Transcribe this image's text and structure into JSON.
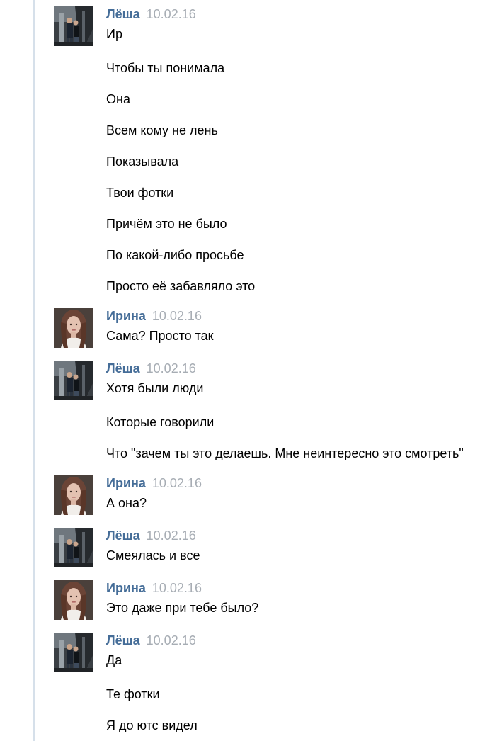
{
  "colors": {
    "author_name": "#456d98",
    "date": "#a7adb4",
    "text": "#000000",
    "left_rule": "#d6e0ea"
  },
  "messages": [
    {
      "author": "Лёша",
      "date": "10.02.16",
      "avatar": "lesha-avatar",
      "lines": [
        "Ир",
        "Чтобы ты понимала",
        "Она",
        "Всем кому не лень",
        "Показывала",
        "Твои фотки",
        "Причём это не было",
        "По какой-либо просьбе",
        "Просто её забавляло это"
      ]
    },
    {
      "author": "Ирина",
      "date": "10.02.16",
      "avatar": "irina-avatar",
      "lines": [
        "Сама? Просто так"
      ]
    },
    {
      "author": "Лёша",
      "date": "10.02.16",
      "avatar": "lesha-avatar",
      "lines": [
        "Хотя были люди",
        "Которые говорили",
        "Что \"зачем ты это делаешь. Мне неинтересно это смотреть\""
      ]
    },
    {
      "author": "Ирина",
      "date": "10.02.16",
      "avatar": "irina-avatar",
      "lines": [
        "А она?"
      ]
    },
    {
      "author": "Лёша",
      "date": "10.02.16",
      "avatar": "lesha-avatar",
      "lines": [
        "Смеялась и все"
      ]
    },
    {
      "author": "Ирина",
      "date": "10.02.16",
      "avatar": "irina-avatar",
      "lines": [
        "Это даже при тебе было?"
      ]
    },
    {
      "author": "Лёша",
      "date": "10.02.16",
      "avatar": "lesha-avatar",
      "lines": [
        "Да",
        "Те фотки",
        "Я до ютс видел"
      ]
    }
  ]
}
